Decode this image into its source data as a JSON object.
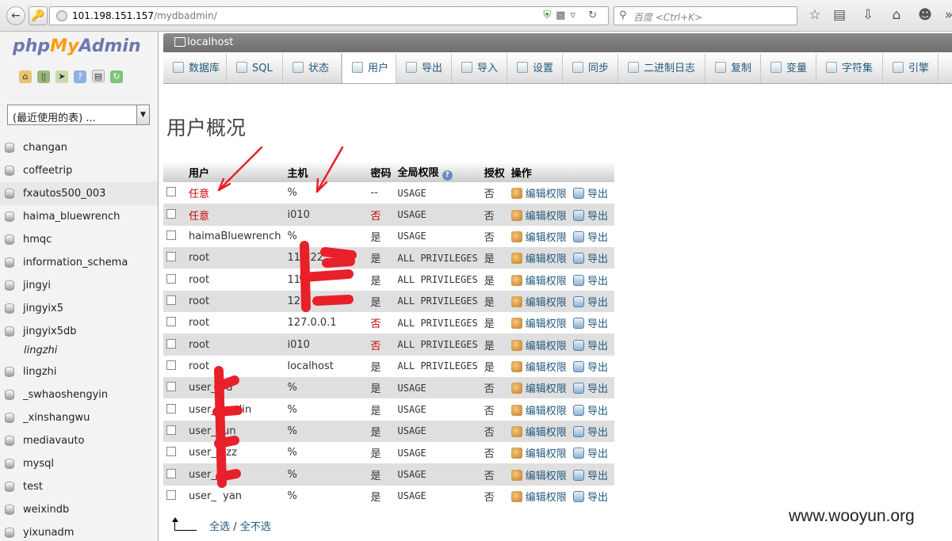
{
  "browser": {
    "url_host": "101.198.151.157",
    "url_path": "/mydbadmin/",
    "search_placeholder": "百度 <Ctrl+K>"
  },
  "leftnav": {
    "logo_php": "php",
    "logo_my": "My",
    "logo_admin": "Admin",
    "db_select": "(最近使用的表) ...",
    "databases": [
      "changan",
      "coffeetrip",
      "fxautos500_003",
      "haima_bluewrench",
      "hmqc",
      "information_schema",
      "jingyi",
      "jingyix5",
      "jingyix5db",
      "lingzhi",
      "lingzhi",
      "_swhaoshengyin",
      "_xinshangwu",
      "mediavauto",
      "mysql",
      "test",
      "weixindb",
      "yixunadm"
    ]
  },
  "server": {
    "label": "localhost"
  },
  "tabs": [
    {
      "label": "数据库",
      "icon": "database-icon"
    },
    {
      "label": "SQL",
      "icon": "sql-icon"
    },
    {
      "label": "状态",
      "icon": "status-icon"
    },
    {
      "label": "用户",
      "icon": "users-icon"
    },
    {
      "label": "导出",
      "icon": "export-icon"
    },
    {
      "label": "导入",
      "icon": "import-icon"
    },
    {
      "label": "设置",
      "icon": "settings-icon"
    },
    {
      "label": "同步",
      "icon": "sync-icon"
    },
    {
      "label": "二进制日志",
      "icon": "binlog-icon"
    },
    {
      "label": "复制",
      "icon": "replication-icon"
    },
    {
      "label": "变量",
      "icon": "variables-icon"
    },
    {
      "label": "字符集",
      "icon": "charset-icon"
    },
    {
      "label": "引擎",
      "icon": "engine-icon"
    }
  ],
  "page_title": "用户概况",
  "table": {
    "headers": {
      "user": "用户",
      "host": "主机",
      "password": "密码",
      "global_priv": "全局权限",
      "grant": "授权",
      "action": "操作"
    },
    "edit_label": "编辑权限",
    "export_label": "导出",
    "rows": [
      {
        "user": "任意",
        "host": "%",
        "password": "--",
        "priv": "USAGE",
        "grant": "否"
      },
      {
        "user": "任意",
        "host": "i010",
        "password": "否",
        "priv": "USAGE",
        "grant": "否"
      },
      {
        "user": "haimaBluewrench",
        "host": "%",
        "password": "是",
        "priv": "USAGE",
        "grant": "否"
      },
      {
        "user": "root",
        "host": "111.‌22.",
        "password": "是",
        "priv": "ALL PRIVILEGES",
        "grant": "是"
      },
      {
        "user": "root",
        "host": "114.",
        "password": "是",
        "priv": "ALL PRIVILEGES",
        "grant": "是"
      },
      {
        "user": "root",
        "host": "121.    42",
        "password": "是",
        "priv": "ALL PRIVILEGES",
        "grant": "是"
      },
      {
        "user": "root",
        "host": "127.0.0.1",
        "password": "否",
        "priv": "ALL PRIVILEGES",
        "grant": "是"
      },
      {
        "user": "root",
        "host": "i010",
        "password": "否",
        "priv": "ALL PRIVILEGES",
        "grant": "是"
      },
      {
        "user": "root",
        "host": "localhost",
        "password": "是",
        "priv": "ALL PRIVILEGES",
        "grant": "是"
      },
      {
        "user": "user_ ‌ ‌ ‌d",
        "host": "%",
        "password": "是",
        "priv": "USAGE",
        "grant": "否"
      },
      {
        "user": "user_ ‌ ‌ ‌unlin",
        "host": "%",
        "password": "是",
        "priv": "USAGE",
        "grant": "否"
      },
      {
        "user": "user_ ‌ un",
        "host": "%",
        "password": "是",
        "priv": "USAGE",
        "grant": "否"
      },
      {
        "user": "user_ ‌ ‌ zz",
        "host": "%",
        "password": "是",
        "priv": "USAGE",
        "grant": "否"
      },
      {
        "user": "user_",
        "host": "%",
        "password": "是",
        "priv": "USAGE",
        "grant": "否"
      },
      {
        "user": "user_ ‌ yan",
        "host": "%",
        "password": "是",
        "priv": "USAGE",
        "grant": "否"
      }
    ]
  },
  "footer": {
    "select_all": "全选",
    "separator": "/",
    "select_none": "全不选"
  },
  "watermark": "www.wooyun.org",
  "colors": {
    "link": "#235a81",
    "red_text": "#cc0000",
    "annotation_red": "#e8202a"
  }
}
